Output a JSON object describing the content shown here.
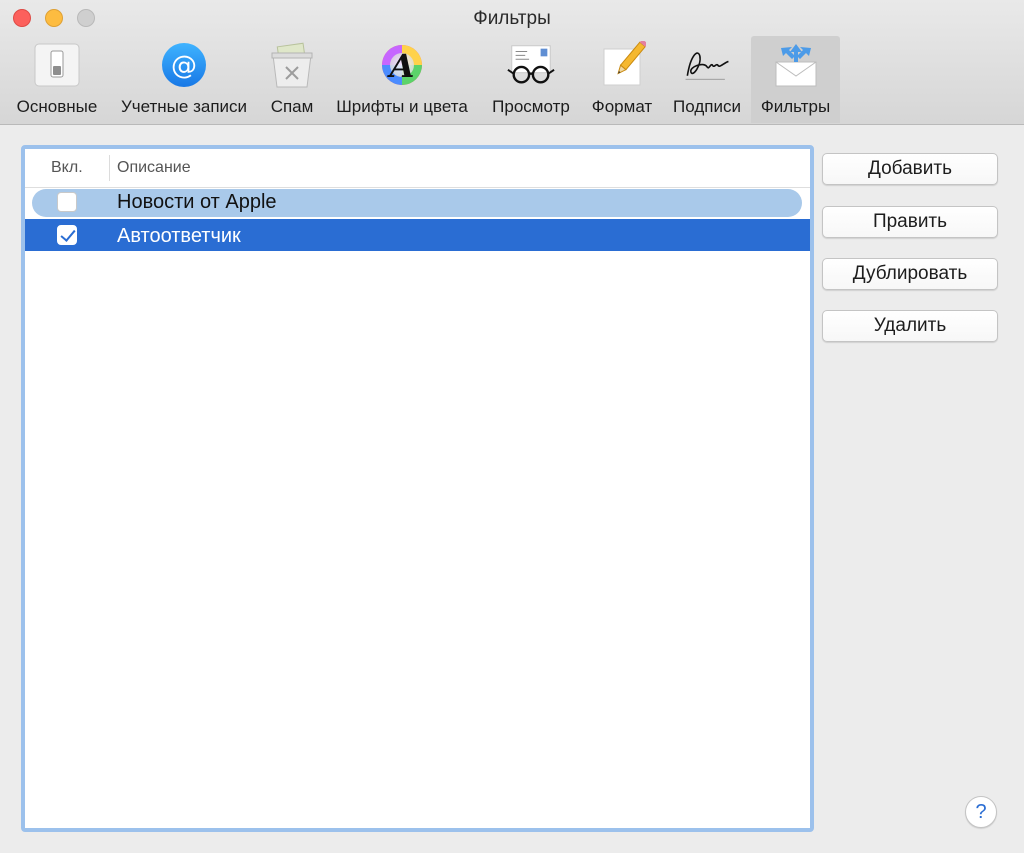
{
  "window": {
    "title": "Фильтры"
  },
  "toolbar": {
    "tabs": [
      {
        "label": "Основные",
        "icon": "switch-icon"
      },
      {
        "label": "Учетные записи",
        "icon": "at-sign-icon"
      },
      {
        "label": "Спам",
        "icon": "junk-bin-icon"
      },
      {
        "label": "Шрифты и цвета",
        "icon": "font-color-icon"
      },
      {
        "label": "Просмотр",
        "icon": "glasses-letter-icon"
      },
      {
        "label": "Формат",
        "icon": "pencil-paper-icon"
      },
      {
        "label": "Подписи",
        "icon": "signature-icon"
      },
      {
        "label": "Фильтры",
        "icon": "filter-envelope-icon"
      }
    ],
    "active_tab": "Фильтры"
  },
  "rules_table": {
    "headers": {
      "enabled": "Вкл.",
      "description": "Описание"
    },
    "rows": [
      {
        "enabled": false,
        "description": "Новости от Apple"
      },
      {
        "enabled": true,
        "description": "Автоответчик"
      }
    ]
  },
  "actions": {
    "add": "Добавить",
    "edit": "Править",
    "duplicate": "Дублировать",
    "remove": "Удалить"
  },
  "help": {
    "label": "?"
  },
  "colors": {
    "selection": "#2a6dd3",
    "selection_inactive": "#a9c9ea",
    "focus_ring": "#9cc1ec",
    "close": "#fc605c",
    "minimize": "#fdbc40"
  }
}
